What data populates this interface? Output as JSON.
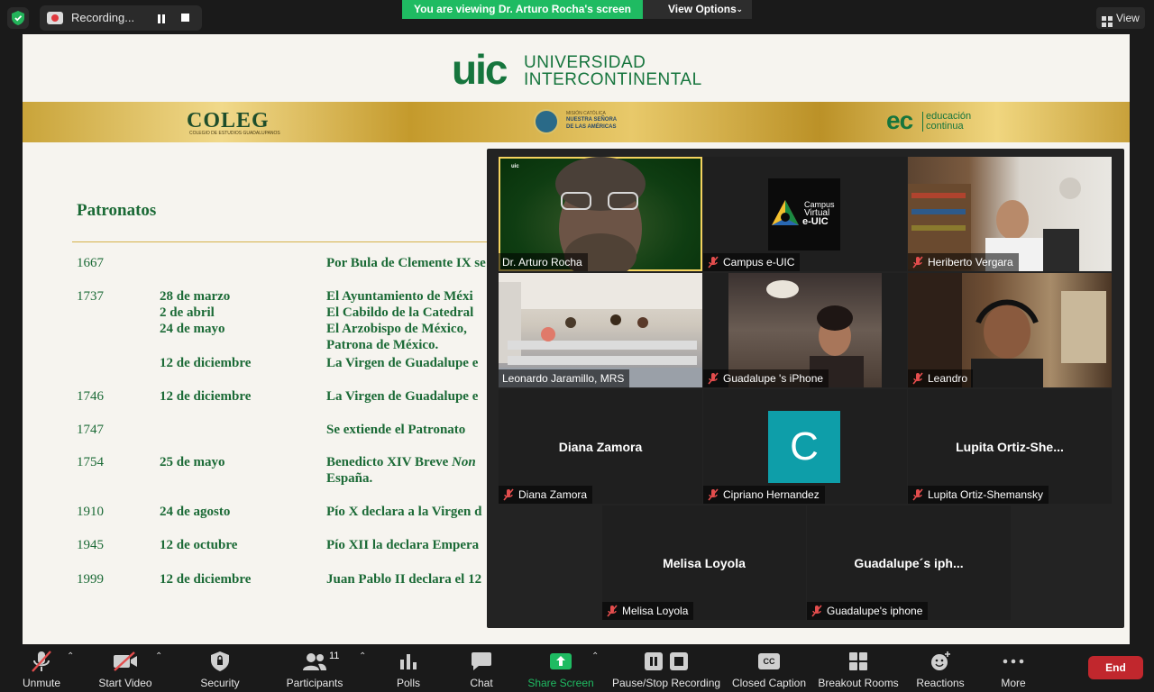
{
  "topbar": {
    "recording_label": "Recording...",
    "viewing_banner": "You are viewing Dr. Arturo Rocha's screen",
    "view_options_label": "View Options",
    "view_label": "View"
  },
  "slide": {
    "uic_mark": "uic",
    "uic_line1": "UNIVERSIDAD",
    "uic_line2": "INTERCONTINENTAL",
    "coleg": "COLEG",
    "coleg_sub": "COLEGIO DE ESTUDIOS GUADALUPANOS",
    "mision_l1": "MISIÓN CATÓLICA",
    "mision_l2": "NUESTRA SEÑORA",
    "mision_l3": "DE LAS AMÉRICAS",
    "ec_mark": "ec",
    "ec_line1": "educación",
    "ec_line2": "continua",
    "title": "Patronatos",
    "rows": [
      {
        "year": "1667",
        "date": "",
        "text": "Por Bula de Clemente IX se instituyó como día de fi"
      },
      {
        "year": "1737",
        "date": "28 de marzo",
        "text": "El Ayuntamiento de Méxi"
      },
      {
        "year": "",
        "date": "2 de abril",
        "text": "El Cabildo de la Catedral"
      },
      {
        "year": "",
        "date": "24 de mayo",
        "text": " El Arzobispo de México,"
      },
      {
        "year": "",
        "date": "",
        "text": "Patrona de México."
      },
      {
        "year": "",
        "date": "12 de diciembre",
        "text": "La Virgen de Guadalupe e"
      },
      {
        "year": "1746",
        "date": "12 de diciembre",
        "text": "La Virgen de Guadalupe e"
      },
      {
        "year": "1747",
        "date": "",
        "text": "Se extiende el Patronato"
      },
      {
        "year": "1754",
        "date": "25 de mayo",
        "text": "Benedicto XIV Breve ",
        "text_italic": "Non"
      },
      {
        "year": "",
        "date": "",
        "text": "España."
      },
      {
        "year": "1910",
        "date": "24 de agosto",
        "text": "Pío X declara a la Virgen d"
      },
      {
        "year": "1945",
        "date": "12 de octubre",
        "text": "Pío XII la declara Empera"
      },
      {
        "year": "1999",
        "date": "12 de diciembre",
        "text": "Juan Pablo II declara el 12"
      }
    ]
  },
  "gallery": {
    "tiles": [
      {
        "name": "Dr. Arturo Rocha",
        "muted": false,
        "active": true
      },
      {
        "name": "Campus e-UIC",
        "muted": true,
        "logo_l1": "Campus",
        "logo_l2": "Virtual",
        "logo_l3": "e-UIC"
      },
      {
        "name": "Heriberto Vergara",
        "muted": true
      },
      {
        "name": "Leonardo Jaramillo, MRS",
        "muted": false
      },
      {
        "name": "Guadalupe  's iPhone",
        "muted": true
      },
      {
        "name": "Leandro",
        "muted": true
      },
      {
        "name": "Diana Zamora",
        "muted": true,
        "center": "Diana Zamora"
      },
      {
        "name": "Cipriano Hernandez",
        "muted": true,
        "avatar_letter": "C"
      },
      {
        "name": "Lupita Ortiz-Shemansky",
        "muted": true,
        "center": "Lupita  Ortiz-She..."
      },
      {
        "name": "Melisa Loyola",
        "muted": true,
        "center": "Melisa Loyola"
      },
      {
        "name": "Guadalupe's iphone",
        "muted": true,
        "center": "Guadalupe´s  iph..."
      }
    ]
  },
  "toolbar": {
    "unmute": "Unmute",
    "start_video": "Start Video",
    "security": "Security",
    "participants": "Participants",
    "participants_count": "11",
    "polls": "Polls",
    "chat": "Chat",
    "share_screen": "Share Screen",
    "pause_stop": "Pause/Stop Recording",
    "closed_caption": "Closed Caption",
    "cc_badge": "CC",
    "breakout": "Breakout Rooms",
    "reactions": "Reactions",
    "more": "More",
    "end": "End"
  },
  "colors": {
    "share_green": "#1fbb62",
    "end_red": "#c1272d",
    "active_speaker": "#f4d35e",
    "slide_green": "#1b6a36"
  }
}
